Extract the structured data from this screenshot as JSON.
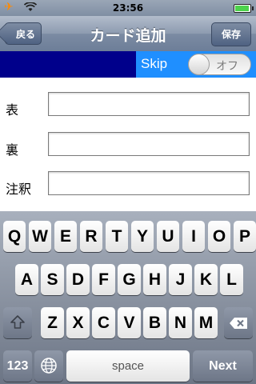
{
  "status_bar": {
    "time": "23:56",
    "icons": [
      "airplane-icon",
      "wifi-icon",
      "battery-icon"
    ]
  },
  "nav": {
    "title": "カード追加",
    "back_label": "戻る",
    "save_label": "保存"
  },
  "skip": {
    "label": "Skip",
    "toggle_text": "オフ",
    "dark_color": "#00008b",
    "blue_color": "#1f8fff"
  },
  "form": {
    "fields": [
      {
        "label": "表",
        "value": ""
      },
      {
        "label": "裏",
        "value": ""
      },
      {
        "label": "注釈",
        "value": ""
      }
    ]
  },
  "keyboard": {
    "row1": [
      "Q",
      "W",
      "E",
      "R",
      "T",
      "Y",
      "U",
      "I",
      "O",
      "P"
    ],
    "row2": [
      "A",
      "S",
      "D",
      "F",
      "G",
      "H",
      "J",
      "K",
      "L"
    ],
    "row3": [
      "Z",
      "X",
      "C",
      "V",
      "B",
      "N",
      "M"
    ],
    "numbers_label": "123",
    "space_label": "space",
    "next_label": "Next"
  }
}
